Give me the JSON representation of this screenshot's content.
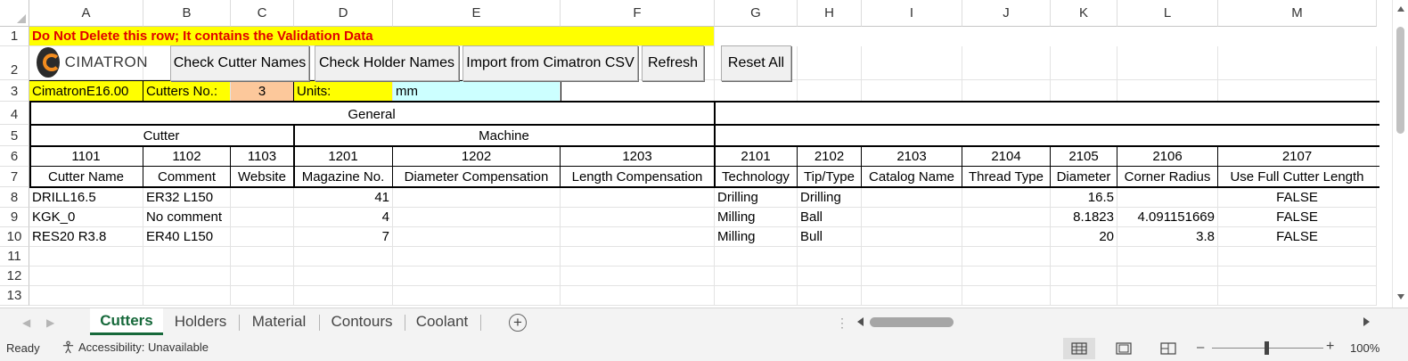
{
  "columns": [
    "A",
    "B",
    "C",
    "D",
    "E",
    "F",
    "G",
    "H",
    "I",
    "J",
    "K",
    "L",
    "M"
  ],
  "rows": [
    "1",
    "2",
    "3",
    "4",
    "5",
    "6",
    "7",
    "8",
    "9",
    "10",
    "11",
    "12",
    "13"
  ],
  "row1": {
    "banner": "Do Not Delete this row; It contains the Validation Data"
  },
  "logo": {
    "text": "CIMATRON"
  },
  "buttons": {
    "check_cutter_names": "Check Cutter Names",
    "check_holder_names": "Check Holder Names",
    "import_csv": "Import from Cimatron CSV",
    "refresh": "Refresh",
    "reset_all": "Reset All"
  },
  "row3": {
    "version": "CimatronE16.00",
    "cutters_label": "Cutters No.:",
    "cutters_count": "3",
    "units_label": "Units:",
    "units_value": "mm"
  },
  "groups": {
    "general": "General",
    "cutter": "Cutter",
    "machine": "Machine"
  },
  "codes": [
    "1101",
    "1102",
    "1103",
    "1201",
    "1202",
    "1203",
    "2101",
    "2102",
    "2103",
    "2104",
    "2105",
    "2106",
    "2107"
  ],
  "headers": [
    "Cutter Name",
    "Comment",
    "Website",
    "Magazine No.",
    "Diameter Compensation",
    "Length Compensation",
    "Technology",
    "Tip/Type",
    "Catalog Name",
    "Thread Type",
    "Diameter",
    "Corner Radius",
    "Use Full Cutter Length"
  ],
  "data_rows": [
    [
      "DRILL16.5",
      "ER32 L150",
      "",
      "41",
      "",
      "",
      "Drilling",
      "Drilling",
      "",
      "",
      "16.5",
      "",
      "FALSE"
    ],
    [
      "KGK_0",
      "No comment",
      "",
      "4",
      "",
      "",
      "Milling",
      "Ball",
      "",
      "",
      "8.1823",
      "4.091151669",
      "FALSE"
    ],
    [
      "RES20 R3.8",
      "ER40 L150",
      "",
      "7",
      "",
      "",
      "Milling",
      "Bull",
      "",
      "",
      "20",
      "3.8",
      "FALSE"
    ]
  ],
  "tabs": [
    "Cutters",
    "Holders",
    "Material",
    "Contours",
    "Coolant"
  ],
  "active_tab": "Cutters",
  "status": {
    "ready": "Ready",
    "accessibility": "Accessibility: Unavailable",
    "zoom": "100%"
  },
  "colors": {
    "banner_bg": "#ffff00",
    "banner_text": "#e00000",
    "count_bg": "#fcc89b",
    "units_bg": "#ccffff",
    "tab_active": "#17693b"
  }
}
